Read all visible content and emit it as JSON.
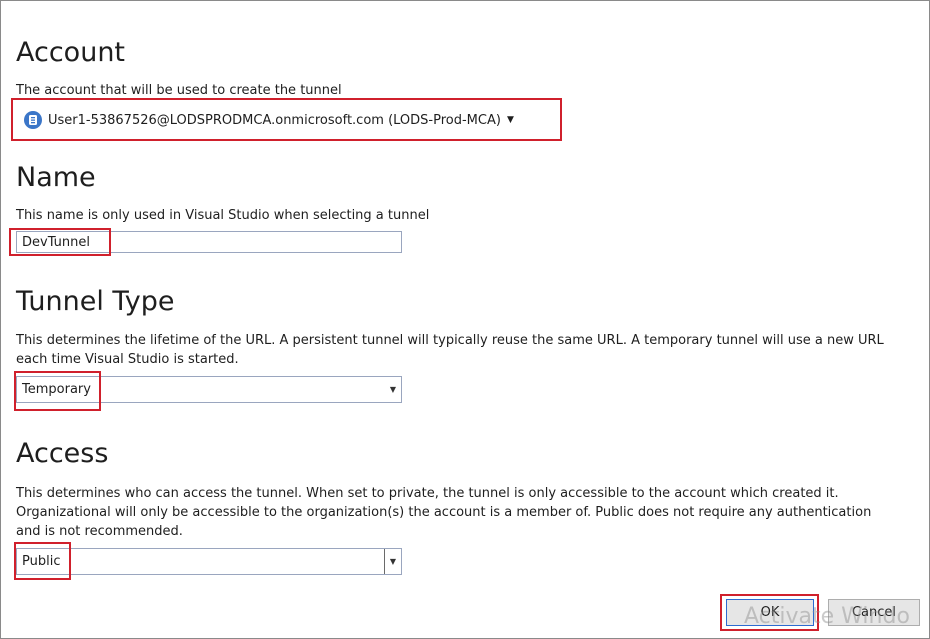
{
  "account": {
    "heading": "Account",
    "description": "The account that will be used to create the tunnel",
    "selected": "User1-53867526@LODSPRODMCA.onmicrosoft.com (LODS-Prod-MCA)",
    "icon": "account-badge-icon"
  },
  "name": {
    "heading": "Name",
    "description": "This name is only used in Visual Studio when selecting a tunnel",
    "value": "DevTunnel"
  },
  "tunnel_type": {
    "heading": "Tunnel Type",
    "description_line1": "This determines the lifetime of the URL. A persistent tunnel will typically reuse the same URL. A temporary tunnel will use a new URL",
    "description_line2": "each time Visual Studio is started.",
    "selected": "Temporary"
  },
  "access": {
    "heading": "Access",
    "description_line1": "This determines who can access the tunnel. When set to private, the tunnel is only accessible to the account which created it.",
    "description_line2": "Organizational will only be accessible to the organization(s) the account is a member of. Public does not require any authentication",
    "description_line3": "and is not recommended.",
    "selected": "Public"
  },
  "buttons": {
    "ok": "OK",
    "cancel": "Cancel"
  },
  "watermark": "Activate Windo",
  "colors": {
    "highlight": "#d0202c",
    "accent": "#2d6bd0"
  }
}
